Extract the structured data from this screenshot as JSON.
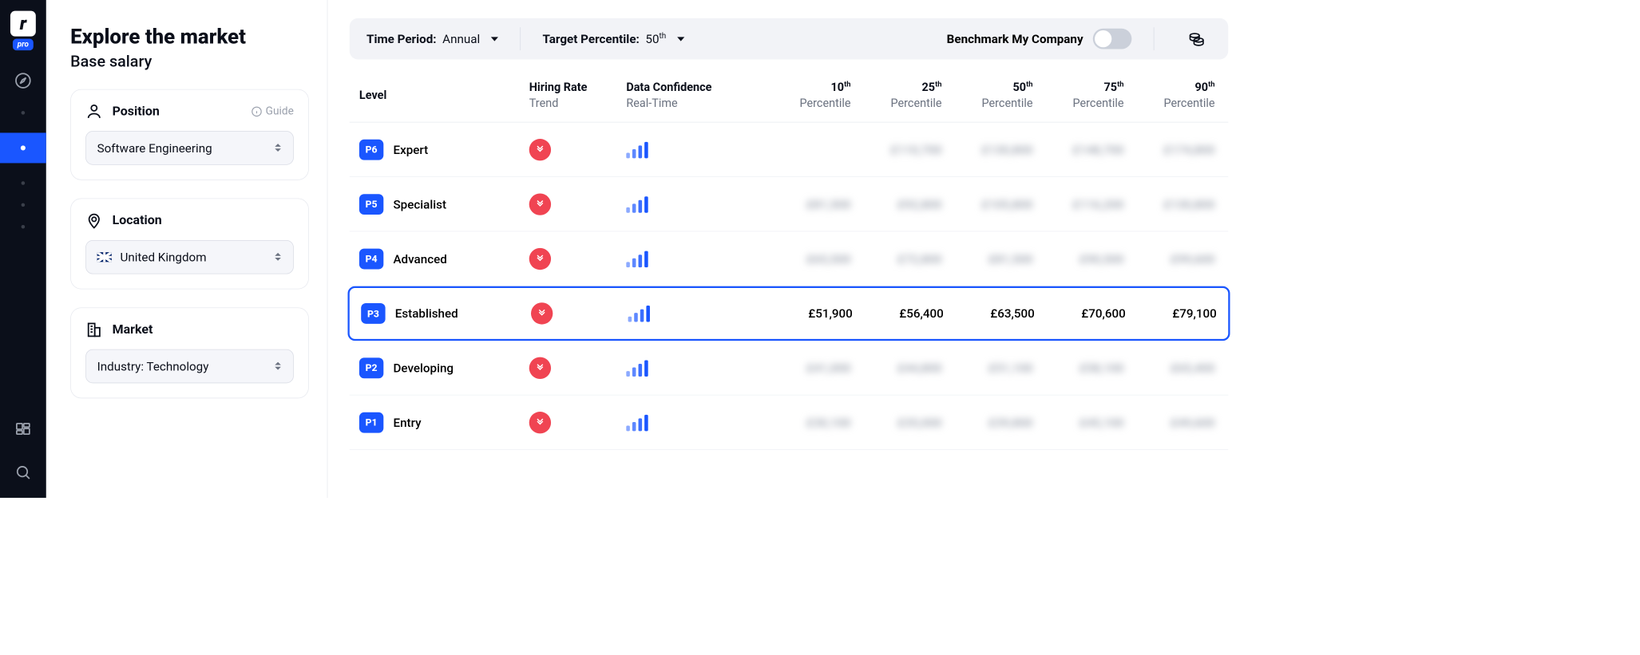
{
  "logo": {
    "letter": "r",
    "tag": "pro"
  },
  "header": {
    "title": "Explore the market",
    "subtitle": "Base salary"
  },
  "panels": {
    "position": {
      "label": "Position",
      "guide": "Guide",
      "value": "Software Engineering"
    },
    "location": {
      "label": "Location",
      "value": "United Kingdom"
    },
    "market": {
      "label": "Market",
      "value": "Industry: Technology"
    }
  },
  "toolbar": {
    "time_label": "Time Period:",
    "time_value": "Annual",
    "target_label": "Target Percentile:",
    "target_value": "50",
    "target_suffix": "th",
    "benchmark_label": "Benchmark My Company"
  },
  "columns": {
    "level": "Level",
    "hiring": "Hiring Rate",
    "hiring_sub": "Trend",
    "conf": "Data Confidence",
    "conf_sub": "Real-Time",
    "p10_a": "10",
    "p25_a": "25",
    "p50_a": "50",
    "p75_a": "75",
    "p90_a": "90",
    "p_suffix": "th",
    "p_label": "Percentile"
  },
  "rows": [
    {
      "badge": "P6",
      "name": "Expert",
      "p10": "",
      "p25": "£110,700",
      "p50": "£130,800",
      "p75": "£148,700",
      "p90": "£174,800",
      "blurred": true,
      "selected": false
    },
    {
      "badge": "P5",
      "name": "Specialist",
      "p10": "£81,500",
      "p25": "£92,800",
      "p50": "£105,800",
      "p75": "£116,200",
      "p90": "£130,800",
      "blurred": true,
      "selected": false
    },
    {
      "badge": "P4",
      "name": "Advanced",
      "p10": "£65,500",
      "p25": "£72,800",
      "p50": "£81,500",
      "p75": "£90,500",
      "p90": "£99,600",
      "blurred": true,
      "selected": false
    },
    {
      "badge": "P3",
      "name": "Established",
      "p10": "£51,900",
      "p25": "£56,400",
      "p50": "£63,500",
      "p75": "£70,600",
      "p90": "£79,100",
      "blurred": false,
      "selected": true
    },
    {
      "badge": "P2",
      "name": "Developing",
      "p10": "£41,000",
      "p25": "£44,800",
      "p50": "£51,100",
      "p75": "£58,100",
      "p90": "£65,400",
      "blurred": true,
      "selected": false
    },
    {
      "badge": "P1",
      "name": "Entry",
      "p10": "£30,100",
      "p25": "£35,000",
      "p50": "£39,800",
      "p75": "£45,100",
      "p90": "£49,600",
      "blurred": true,
      "selected": false
    }
  ]
}
